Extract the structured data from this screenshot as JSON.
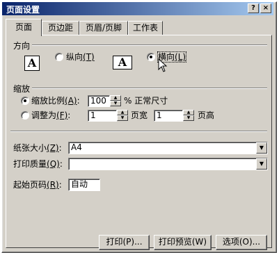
{
  "dialog": {
    "title": "页面设置",
    "help_label": "?",
    "close_label": "×"
  },
  "tabs": [
    {
      "label": "页面",
      "active": true
    },
    {
      "label": "页边距"
    },
    {
      "label": "页眉/页脚"
    },
    {
      "label": "工作表"
    }
  ],
  "orientation": {
    "section_label": "方向",
    "portrait_label": "纵向",
    "portrait_key": "(T)",
    "landscape_label": "横向",
    "landscape_key": "(L)",
    "selected": "landscape",
    "icon_letter": "A"
  },
  "scaling": {
    "section_label": "缩放",
    "adjust_label": "缩放比例",
    "adjust_key": "(A)",
    "adjust_colon": ":",
    "adjust_value": "100",
    "adjust_suffix": "% 正常尺寸",
    "fit_label": "调整为",
    "fit_key": "(F)",
    "fit_colon": ":",
    "fit_wide_value": "1",
    "fit_wide_suffix": "页宽",
    "fit_tall_value": "1",
    "fit_tall_suffix": "页高",
    "selected": "adjust"
  },
  "paper_size": {
    "label": "纸张大小",
    "key": "(Z)",
    "colon": ":",
    "value": "A4"
  },
  "print_quality": {
    "label": "打印质量",
    "key": "(Q)",
    "colon": ":",
    "value": ""
  },
  "first_page": {
    "label": "起始页码",
    "key": "(R)",
    "colon": ":",
    "value": "自动"
  },
  "buttons": {
    "print_label": "打印(P)...",
    "preview_label": "打印预览(W)",
    "options_label": "选项(O)..."
  },
  "icons": {
    "spin_up": "▲",
    "spin_down": "▼",
    "dropdown": "▼"
  }
}
